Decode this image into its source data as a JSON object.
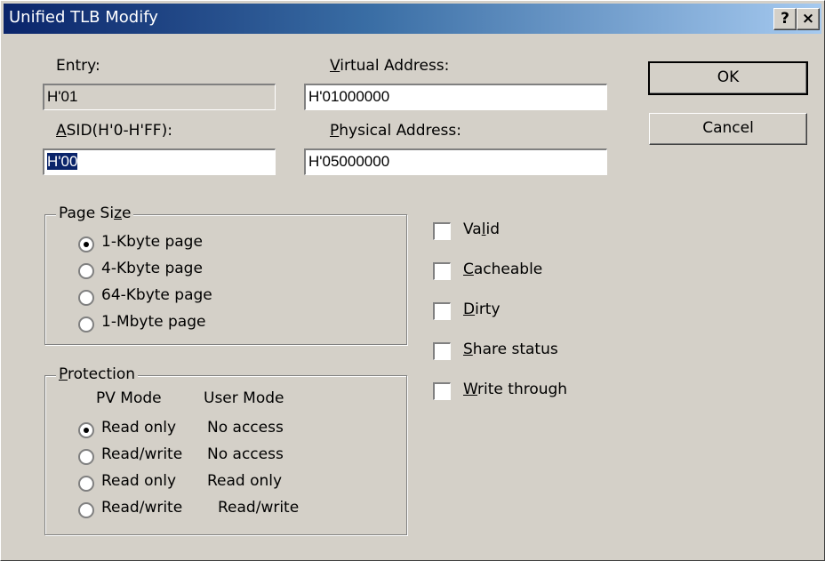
{
  "window": {
    "title": "Unified TLB Modify",
    "help_label": "?",
    "close_label": "×"
  },
  "fields": {
    "entry": {
      "label": "Entry:",
      "value": "H'01"
    },
    "virtual_address": {
      "label_u": "V",
      "label_rest": "irtual Address:",
      "value": "H'01000000"
    },
    "asid": {
      "label_u": "A",
      "label_rest": "SID(H'0-H'FF):",
      "value": "H'00"
    },
    "physical_address": {
      "label_u": "P",
      "label_rest": "hysical Address:",
      "value": "H'05000000"
    }
  },
  "buttons": {
    "ok": "OK",
    "cancel": "Cancel"
  },
  "page_size": {
    "legend_pre": "Page Si",
    "legend_u": "z",
    "legend_post": "e",
    "options": [
      "1-Kbyte page",
      "4-Kbyte page",
      "64-Kbyte page",
      "1-Mbyte page"
    ],
    "selected": 0
  },
  "protection": {
    "legend_u": "P",
    "legend_rest": "rotection",
    "col_pv": "PV Mode",
    "col_user": "User Mode",
    "rows": [
      {
        "pv": "Read only",
        "user": "No access"
      },
      {
        "pv": "Read/write",
        "user": "No access"
      },
      {
        "pv": "Read only",
        "user": "Read only"
      },
      {
        "pv": "Read/write",
        "user": "Read/write"
      }
    ],
    "selected": 0
  },
  "checkboxes": {
    "valid": {
      "pre": "Va",
      "u": "l",
      "post": "id",
      "checked": false
    },
    "cacheable": {
      "pre": "",
      "u": "C",
      "post": "acheable",
      "checked": false
    },
    "dirty": {
      "pre": "",
      "u": "D",
      "post": "irty",
      "checked": false
    },
    "share_status": {
      "pre": "",
      "u": "S",
      "post": "hare status",
      "checked": false
    },
    "write_through": {
      "pre": "",
      "u": "W",
      "post": "rite through",
      "checked": false
    }
  }
}
